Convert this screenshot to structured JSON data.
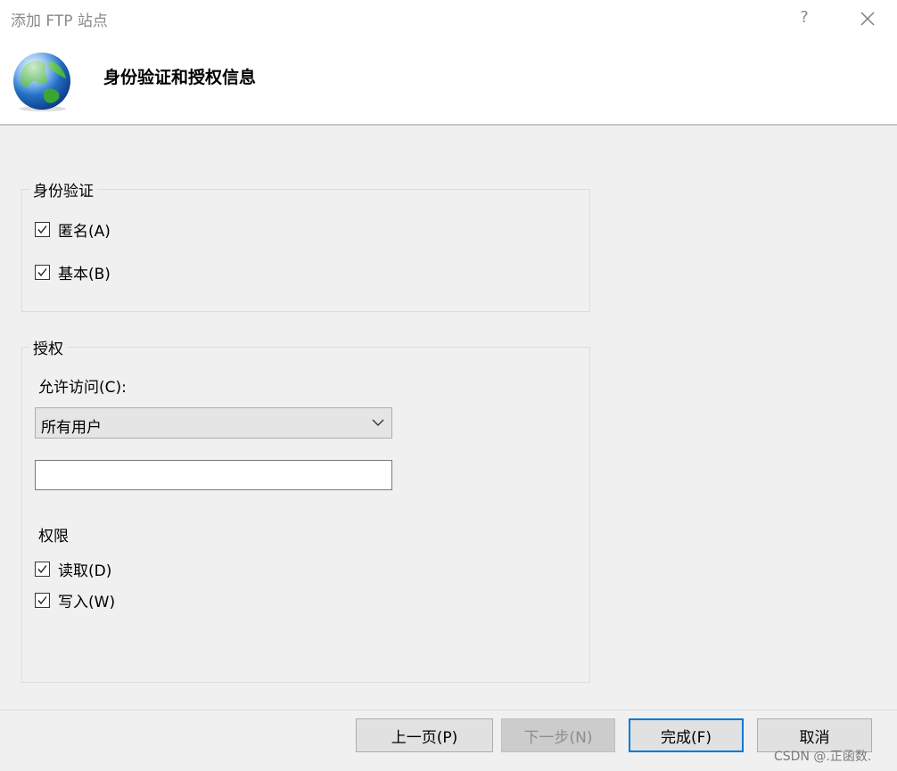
{
  "window": {
    "title": "添加 FTP 站点",
    "help_label": "?",
    "close_icon": "close-icon"
  },
  "header": {
    "title": "身份验证和授权信息",
    "icon": "globe-icon"
  },
  "authentication": {
    "legend": "身份验证",
    "anonymous": {
      "label": "匿名(A)",
      "checked": true
    },
    "basic": {
      "label": "基本(B)",
      "checked": true
    }
  },
  "authorization": {
    "legend": "授权",
    "allow_access_label": "允许访问(C):",
    "allow_access_value": "所有用户",
    "user_field_value": "",
    "permissions_label": "权限",
    "read": {
      "label": "读取(D)",
      "checked": true
    },
    "write": {
      "label": "写入(W)",
      "checked": true
    }
  },
  "buttons": {
    "previous": "上一页(P)",
    "next": "下一步(N)",
    "finish": "完成(F)",
    "cancel": "取消"
  },
  "watermark": "CSDN @.正函数.",
  "colors": {
    "accent": "#0078d7",
    "dialog_background": "#f0f0f0",
    "header_background": "#ffffff"
  }
}
